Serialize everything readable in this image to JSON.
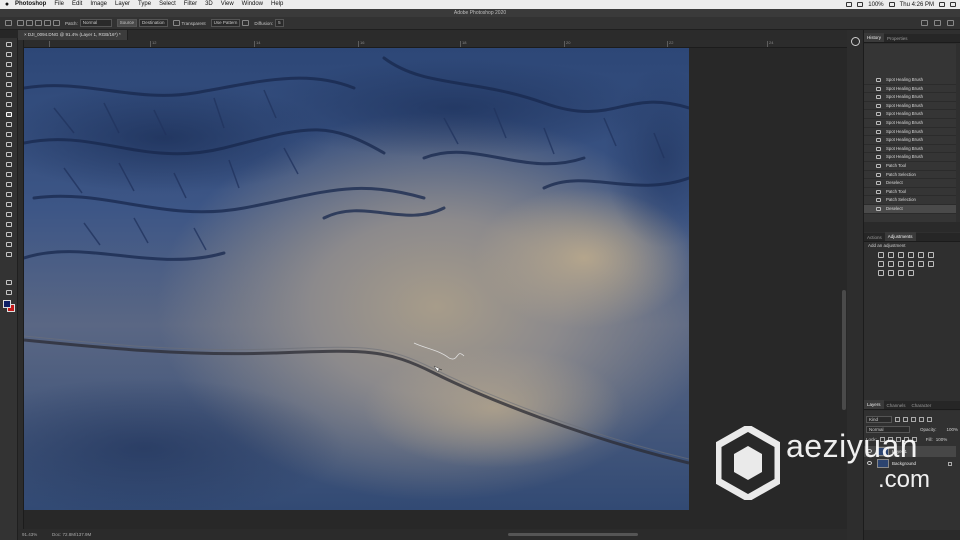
{
  "menubar": {
    "app_name": "Photoshop",
    "menus": [
      "File",
      "Edit",
      "Image",
      "Layer",
      "Type",
      "Select",
      "Filter",
      "3D",
      "View",
      "Window",
      "Help"
    ],
    "battery": "100%",
    "clock": "Thu 4:26 PM"
  },
  "app_title": "Adobe Photoshop 2020",
  "options_bar": {
    "patch_label": "Patch:",
    "patch_mode": "Normal",
    "source_label": "Source",
    "destination_label": "Destination",
    "transparent_label": "Transparent",
    "use_pattern_label": "Use Pattern",
    "diffusion_label": "Diffusion:",
    "diffusion_value": "5"
  },
  "document": {
    "tab_title": "DJI_0094.DNG @ 91.4% (Layer 1, RGB/16*) *",
    "zoom_status": "91.43%",
    "doc_info": "Doc: 72.8M/137.9M"
  },
  "ruler": {
    "labels": [
      "12",
      "14",
      "16",
      "18",
      "20",
      "22",
      "24",
      "26"
    ]
  },
  "history": {
    "tab_history": "History",
    "tab_properties": "Properties",
    "items": [
      "Spot Healing Brush",
      "Spot Healing Brush",
      "Spot Healing Brush",
      "Spot Healing Brush",
      "Spot Healing Brush",
      "Spot Healing Brush",
      "Spot Healing Brush",
      "Spot Healing Brush",
      "Spot Healing Brush",
      "Spot Healing Brush",
      "Patch Tool",
      "Patch Selection",
      "Deselect",
      "Patch Tool",
      "Patch Selection",
      "Deselect"
    ]
  },
  "adjustments": {
    "tab_actions": "Actions",
    "tab_adjustments": "Adjustments",
    "add_label": "Add an adjustment"
  },
  "layers": {
    "tab_layers": "Layers",
    "tab_channels": "Channels",
    "tab_character": "Character",
    "filter_kind": "Kind",
    "blend_mode": "Normal",
    "opacity_label": "Opacity:",
    "opacity_value": "100%",
    "lock_label": "Lock:",
    "fill_label": "Fill:",
    "fill_value": "100%",
    "items": [
      {
        "name": "Layer 1"
      },
      {
        "name": "Background"
      }
    ]
  },
  "watermark": {
    "text": "aeziyuan",
    "domain": ".com"
  },
  "colors": {
    "foreground": "#0d1f66",
    "background": "#c41919",
    "ui_dark": "#262626",
    "panel": "#2f2f2f"
  }
}
